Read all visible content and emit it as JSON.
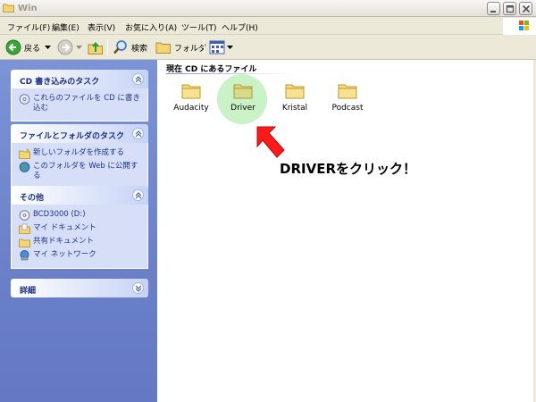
{
  "window": {
    "title": "Win"
  },
  "menu": [
    "ファイル(F)",
    "編集(E)",
    "表示(V)",
    "お気に入り(A)",
    "ツール(T)",
    "ヘルプ(H)"
  ],
  "toolbar": {
    "back_label": "戻る",
    "search_label": "検索",
    "folders_label": "フォルダ"
  },
  "panels": {
    "cd_tasks": {
      "title": "CD 書き込みのタスク",
      "items": [
        "これらのファイルを CD に書き込む"
      ]
    },
    "file_tasks": {
      "title": "ファイルとフォルダのタスク",
      "items": [
        "新しいフォルダを作成する",
        "このフォルダを Web に公開する"
      ]
    },
    "other": {
      "title": "その他",
      "items": [
        "BCD3000 (D:)",
        "マイ ドキュメント",
        "共有ドキュメント",
        "マイ ネットワーク"
      ]
    },
    "details": {
      "title": "詳細"
    }
  },
  "content": {
    "heading": "現在 CD にあるファイル",
    "files": [
      "Audacity",
      "Driver",
      "Kristal",
      "Podcast"
    ]
  },
  "annotation": {
    "text": "DRIVERをクリック！",
    "highlight_color": "#c9f2c6",
    "arrow_color": "#ff0000"
  }
}
